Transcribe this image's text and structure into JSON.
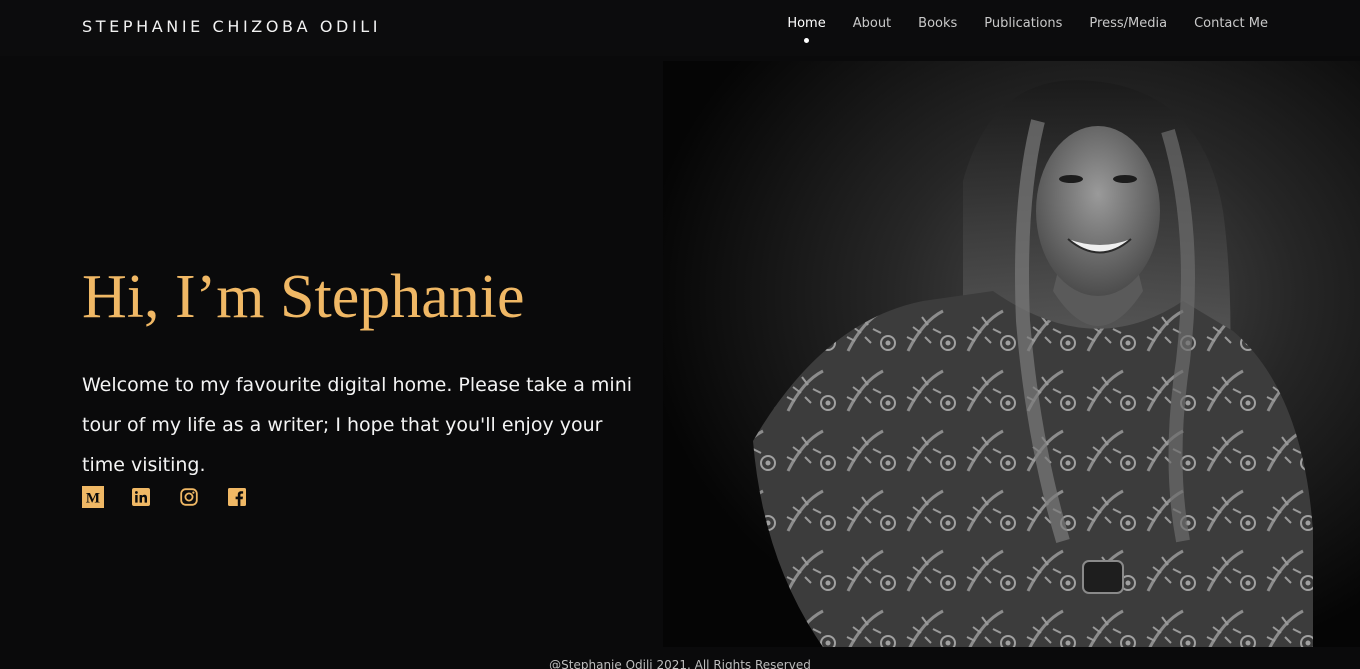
{
  "header": {
    "brand": "STEPHANIE CHIZOBA ODILI",
    "nav": [
      {
        "label": "Home",
        "active": true
      },
      {
        "label": "About",
        "active": false
      },
      {
        "label": "Books",
        "active": false
      },
      {
        "label": "Publications",
        "active": false
      },
      {
        "label": "Press/Media",
        "active": false
      },
      {
        "label": "Contact Me",
        "active": false
      }
    ]
  },
  "hero": {
    "title": "Hi, I’m Stephanie",
    "intro": "Welcome to my favourite digital home. Please take a mini tour of my life as a writer; I hope that you'll enjoy your time visiting.",
    "photo_alt": "black-and-white portrait of a smiling woman in a floral top"
  },
  "socials": [
    {
      "name": "medium-icon",
      "glyph": "M"
    },
    {
      "name": "linkedin-icon",
      "glyph": "in"
    },
    {
      "name": "instagram-icon",
      "glyph": ""
    },
    {
      "name": "facebook-icon",
      "glyph": "f"
    }
  ],
  "footer": {
    "copyright": "@Stephanie Odili 2021. All Rights Reserved"
  },
  "colors": {
    "background": "#0a0a0b",
    "accent": "#f0b865",
    "text": "#f4f4f4"
  }
}
